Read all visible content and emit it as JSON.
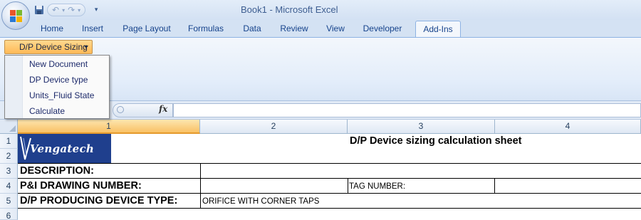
{
  "window": {
    "title": "Book1 - Microsoft Excel"
  },
  "quick_access": {
    "save_icon": "save-icon",
    "undo_icon": "undo-icon",
    "redo_icon": "redo-icon",
    "customize_icon": "customize-qat-icon"
  },
  "ribbon": {
    "tabs": [
      {
        "label": "Home"
      },
      {
        "label": "Insert"
      },
      {
        "label": "Page Layout"
      },
      {
        "label": "Formulas"
      },
      {
        "label": "Data"
      },
      {
        "label": "Review"
      },
      {
        "label": "View"
      },
      {
        "label": "Developer"
      },
      {
        "label": "Add-Ins",
        "active": true
      }
    ],
    "dp_button_label": "D/P Device Sizing"
  },
  "menu": {
    "items": [
      {
        "label": "New Document"
      },
      {
        "label": "DP Device type"
      },
      {
        "label": "Units_Fluid State"
      },
      {
        "label": "Calculate"
      }
    ]
  },
  "formula_bar": {
    "fx_label": "fx",
    "value": ""
  },
  "grid": {
    "columns": [
      "1",
      "2",
      "3",
      "4"
    ],
    "selected_column": "1",
    "rows": [
      "1",
      "2",
      "3",
      "4",
      "5",
      "6"
    ]
  },
  "sheet": {
    "logo_text": "Vengatech",
    "title": "D/P Device sizing calculation sheet",
    "description_label": "DESCRIPTION:",
    "pid_label": "P&I DRAWING NUMBER:",
    "tag_label": "TAG NUMBER:",
    "device_type_label": "D/P PRODUCING DEVICE TYPE:",
    "device_type_value": "ORIFICE WITH CORNER TAPS"
  },
  "colors": {
    "accent_orange": "#f9c165",
    "ribbon_blue": "#d4e2f3",
    "logo_blue": "#1f3f8d"
  }
}
